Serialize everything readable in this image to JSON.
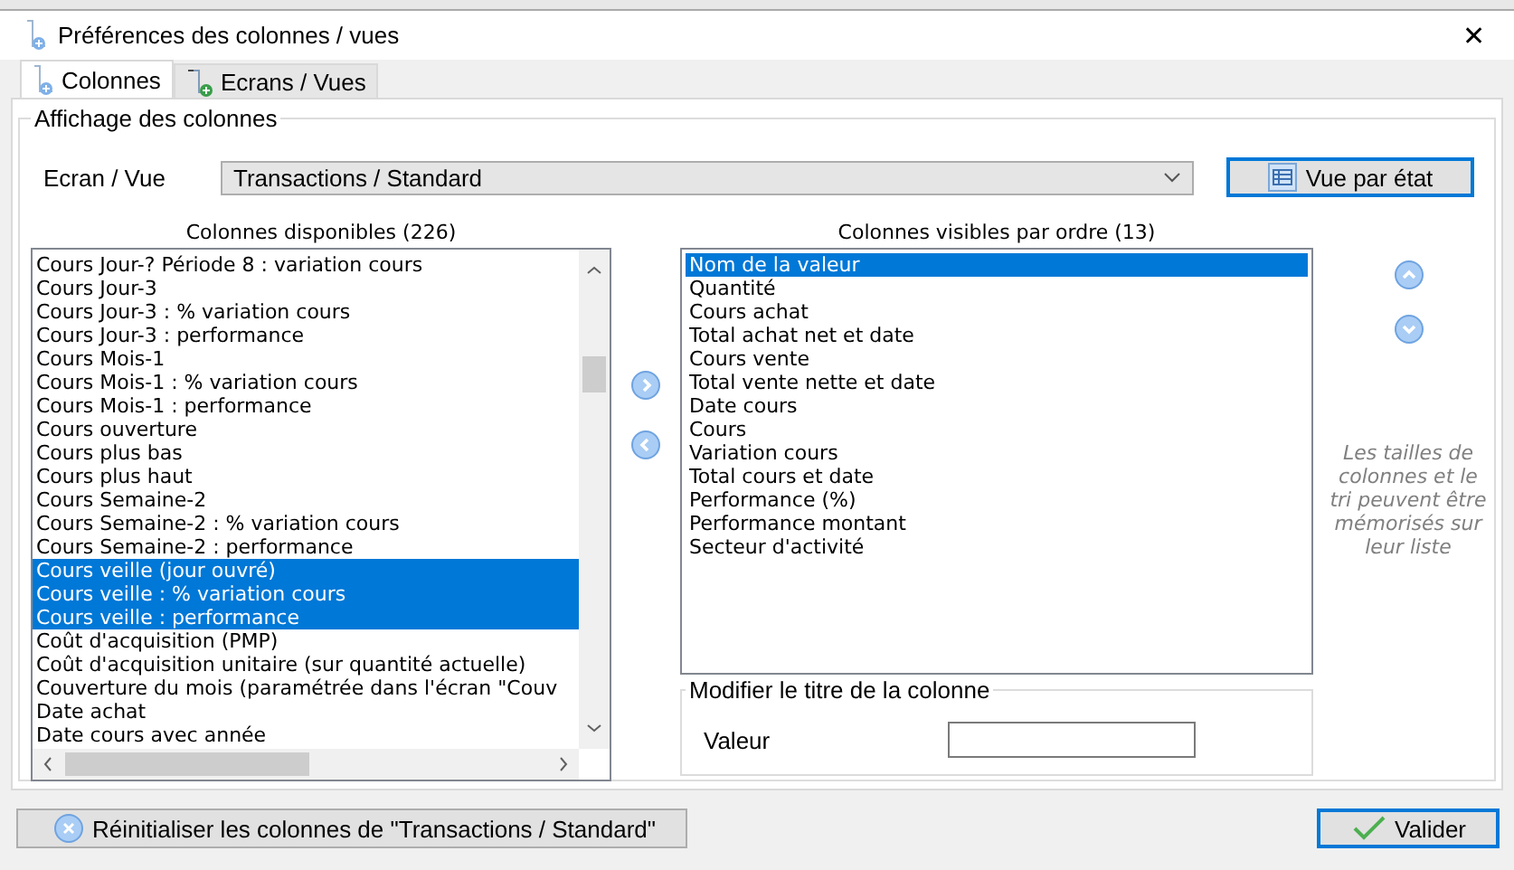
{
  "window": {
    "title": "Préférences des colonnes / vues",
    "close": "✕"
  },
  "tabs": [
    {
      "label": "Colonnes",
      "selected": true
    },
    {
      "label": "Ecrans / Vues",
      "selected": false
    }
  ],
  "group": {
    "title": "Affichage des colonnes"
  },
  "view_select": {
    "label": "Ecran / Vue",
    "value": "Transactions / Standard"
  },
  "state_view_button": "Vue par état",
  "available": {
    "title": "Colonnes disponibles (226)",
    "items": [
      {
        "label": "Cours Jour-? Période 8 : variation cours",
        "selected": false
      },
      {
        "label": "Cours Jour-3",
        "selected": false
      },
      {
        "label": "Cours Jour-3 : % variation cours",
        "selected": false
      },
      {
        "label": "Cours Jour-3 : performance",
        "selected": false
      },
      {
        "label": "Cours Mois-1",
        "selected": false
      },
      {
        "label": "Cours Mois-1 : % variation cours",
        "selected": false
      },
      {
        "label": "Cours Mois-1 : performance",
        "selected": false
      },
      {
        "label": "Cours ouverture",
        "selected": false
      },
      {
        "label": "Cours plus bas",
        "selected": false
      },
      {
        "label": "Cours plus haut",
        "selected": false
      },
      {
        "label": "Cours Semaine-2",
        "selected": false
      },
      {
        "label": "Cours Semaine-2 : % variation cours",
        "selected": false
      },
      {
        "label": "Cours Semaine-2 : performance",
        "selected": false
      },
      {
        "label": "Cours veille (jour ouvré)",
        "selected": true
      },
      {
        "label": "Cours veille : % variation cours",
        "selected": true
      },
      {
        "label": "Cours veille : performance",
        "selected": true
      },
      {
        "label": "Coût d'acquisition (PMP)",
        "selected": false
      },
      {
        "label": "Coût d'acquisition unitaire (sur quantité actuelle)",
        "selected": false
      },
      {
        "label": "Couverture du mois (paramétrée dans l'écran \"Couv",
        "selected": false
      },
      {
        "label": "Date achat",
        "selected": false
      },
      {
        "label": "Date cours avec année",
        "selected": false
      }
    ]
  },
  "visible": {
    "title": "Colonnes visibles par ordre (13)",
    "items": [
      {
        "label": "Nom de la valeur",
        "selected": true
      },
      {
        "label": "Quantité",
        "selected": false
      },
      {
        "label": "Cours achat",
        "selected": false
      },
      {
        "label": "Total achat net et date",
        "selected": false
      },
      {
        "label": "Cours vente",
        "selected": false
      },
      {
        "label": "Total vente nette et date",
        "selected": false
      },
      {
        "label": "Date cours",
        "selected": false
      },
      {
        "label": "Cours",
        "selected": false
      },
      {
        "label": "Variation cours",
        "selected": false
      },
      {
        "label": "Total cours et date",
        "selected": false
      },
      {
        "label": "Performance (%)",
        "selected": false
      },
      {
        "label": "Performance montant",
        "selected": false
      },
      {
        "label": "Secteur d'activité",
        "selected": false
      }
    ]
  },
  "hint": "Les tailles de colonnes et le tri peuvent être mémorisés sur leur liste",
  "rename": {
    "title": "Modifier le titre de la colonne",
    "label": "Valeur"
  },
  "reset_button": "Réinitialiser les colonnes de \"Transactions / Standard\"",
  "ok_button": "Valider"
}
